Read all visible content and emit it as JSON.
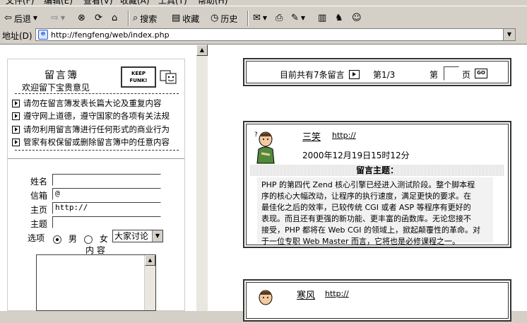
{
  "menu": [
    "文件(F)",
    "编辑(E)",
    "查看(V)",
    "收藏(A)",
    "工具(T)",
    "帮助(H)"
  ],
  "toolbar": {
    "back_label": "后退",
    "search_label": "搜索",
    "favorites_label": "收藏",
    "history_label": "历史"
  },
  "address": {
    "label": "地址(D)",
    "url": "http://fengfeng/web/index.php"
  },
  "guestbook": {
    "title": "留言簿",
    "subtitle": "欢迎留下宝贵意见",
    "badge": "KEEP FUNK!",
    "rules": [
      "请勿在留言簿发表长篇大论及重复内容",
      "遵守网上道德，遵守国家的各项有关法规",
      "请勿利用留言簿进行任何形式的商业行为",
      "管家有权保留或删除留言簿中的任意内容"
    ],
    "form": {
      "name_label": "姓名",
      "email_label": "信箱",
      "email_value": "@",
      "homepage_label": "主页",
      "homepage_value": "http://",
      "subject_label": "主题",
      "options_label": "选项",
      "gender_male": "男",
      "gender_female": "女",
      "category_selected": "大家讨论",
      "content_label": "内 容"
    }
  },
  "pager": {
    "total_text": "目前共有7条留言",
    "page_text": "第1/3",
    "goto_prefix": "第",
    "goto_suffix": "页",
    "go_label": "GO"
  },
  "posts": [
    {
      "author": "三笑",
      "homepage": "http://",
      "date": "2000年12月19日15时12分",
      "subject_label": "留言主题：",
      "body_lines": [
        "PHP 的第四代 Zend 核心引擎已经进入测试阶段。整个脚本程",
        "序的核心大幅改动，让程序的执行速度，满足更快的要求。在",
        "最佳化之后的效率，已较传统 CGI 或者 ASP 等程序有更好的",
        "表现。而且还有更强的新功能、更丰富的函数库。无论您接不",
        "接受，PHP 都将在 Web CGI 的领域上，掀起颠覆性的革命。对",
        "于一位专职 Web Master 而言，它将也是必修课程之一。"
      ]
    },
    {
      "author": "寒风",
      "homepage": "http://"
    }
  ]
}
